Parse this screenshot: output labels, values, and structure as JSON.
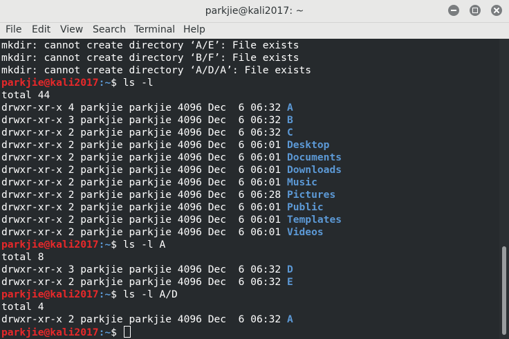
{
  "window": {
    "title": "parkjie@kali2017: ~"
  },
  "menubar": [
    "File",
    "Edit",
    "View",
    "Search",
    "Terminal",
    "Help"
  ],
  "prompt": {
    "user_host": "parkjie@kali2017",
    "path": ":~",
    "symbol": "$ "
  },
  "colors": {
    "prompt": "#e9282a",
    "directory": "#5c99d6",
    "background": "#262a2d",
    "text": "#ffffff"
  },
  "terminal": {
    "lines": [
      {
        "kind": "text",
        "text": "mkdir: cannot create directory ‘A/E’: File exists"
      },
      {
        "kind": "text",
        "text": "mkdir: cannot create directory ‘B/F’: File exists"
      },
      {
        "kind": "text",
        "text": "mkdir: cannot create directory ‘A/D/A’: File exists"
      },
      {
        "kind": "prompt",
        "cmd": "ls -l"
      },
      {
        "kind": "text",
        "text": "total 44"
      },
      {
        "kind": "entry",
        "meta": "drwxr-xr-x 4 parkjie parkjie 4096 Dec  6 06:32 ",
        "name": "A"
      },
      {
        "kind": "entry",
        "meta": "drwxr-xr-x 3 parkjie parkjie 4096 Dec  6 06:32 ",
        "name": "B"
      },
      {
        "kind": "entry",
        "meta": "drwxr-xr-x 2 parkjie parkjie 4096 Dec  6 06:32 ",
        "name": "C"
      },
      {
        "kind": "entry",
        "meta": "drwxr-xr-x 2 parkjie parkjie 4096 Dec  6 06:01 ",
        "name": "Desktop"
      },
      {
        "kind": "entry",
        "meta": "drwxr-xr-x 2 parkjie parkjie 4096 Dec  6 06:01 ",
        "name": "Documents"
      },
      {
        "kind": "entry",
        "meta": "drwxr-xr-x 2 parkjie parkjie 4096 Dec  6 06:01 ",
        "name": "Downloads"
      },
      {
        "kind": "entry",
        "meta": "drwxr-xr-x 2 parkjie parkjie 4096 Dec  6 06:01 ",
        "name": "Music"
      },
      {
        "kind": "entry",
        "meta": "drwxr-xr-x 2 parkjie parkjie 4096 Dec  6 06:28 ",
        "name": "Pictures"
      },
      {
        "kind": "entry",
        "meta": "drwxr-xr-x 2 parkjie parkjie 4096 Dec  6 06:01 ",
        "name": "Public"
      },
      {
        "kind": "entry",
        "meta": "drwxr-xr-x 2 parkjie parkjie 4096 Dec  6 06:01 ",
        "name": "Templates"
      },
      {
        "kind": "entry",
        "meta": "drwxr-xr-x 2 parkjie parkjie 4096 Dec  6 06:01 ",
        "name": "Videos"
      },
      {
        "kind": "prompt",
        "cmd": "ls -l A"
      },
      {
        "kind": "text",
        "text": "total 8"
      },
      {
        "kind": "entry",
        "meta": "drwxr-xr-x 3 parkjie parkjie 4096 Dec  6 06:32 ",
        "name": "D"
      },
      {
        "kind": "entry",
        "meta": "drwxr-xr-x 2 parkjie parkjie 4096 Dec  6 06:32 ",
        "name": "E"
      },
      {
        "kind": "prompt",
        "cmd": "ls -l A/D"
      },
      {
        "kind": "text",
        "text": "total 4"
      },
      {
        "kind": "entry",
        "meta": "drwxr-xr-x 2 parkjie parkjie 4096 Dec  6 06:32 ",
        "name": "A"
      },
      {
        "kind": "prompt",
        "cmd": "",
        "cursor": true
      }
    ]
  }
}
